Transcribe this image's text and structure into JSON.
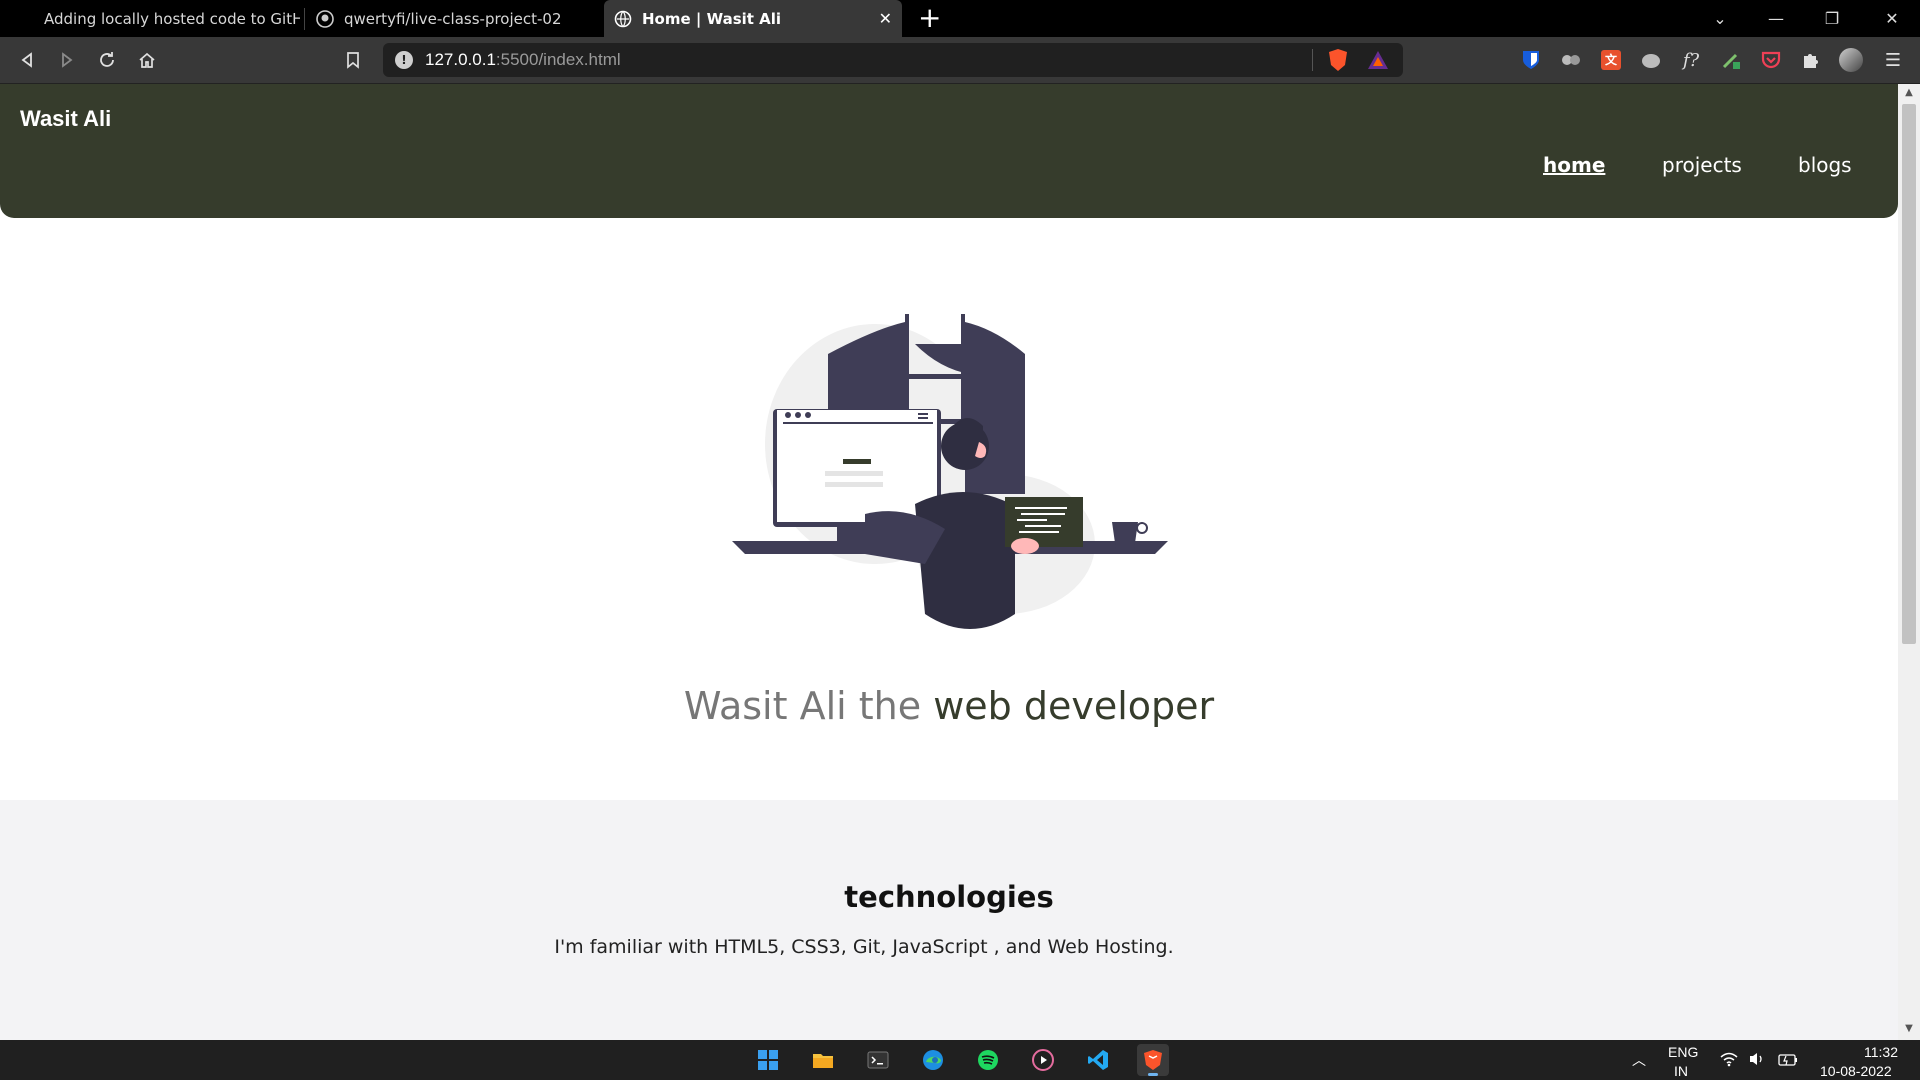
{
  "browser": {
    "tabs": [
      {
        "title": "Adding locally hosted code to GitHub",
        "active": false
      },
      {
        "title": "qwertyfi/live-class-project-02",
        "active": false
      },
      {
        "title": "Home | Wasit Ali",
        "active": true
      }
    ],
    "new_tab_symbol": "+",
    "close_tab_symbol": "✕",
    "address": {
      "host": "127.0.0.1",
      "path": ":5500/index.html"
    }
  },
  "site": {
    "brand": "Wasit Ali",
    "nav": [
      {
        "label": "home",
        "active": true
      },
      {
        "label": "projects",
        "active": false
      },
      {
        "label": "blogs",
        "active": false
      }
    ],
    "hero": {
      "title_plain": "Wasit Ali the ",
      "title_accent": "web developer"
    },
    "tech": {
      "heading": "technologies",
      "text": "I'm familiar with HTML5, CSS3, Git, JavaScript , and Web Hosting."
    }
  },
  "taskbar": {
    "language": "ENG",
    "region": "IN",
    "time": "11:32",
    "date": "10-08-2022"
  },
  "colors": {
    "nav_bg": "#363c2c",
    "accent_text": "#363c2c",
    "muted_text": "#777777",
    "section_bg": "#f3f3f5",
    "illustration_dark": "#3f3d56"
  }
}
